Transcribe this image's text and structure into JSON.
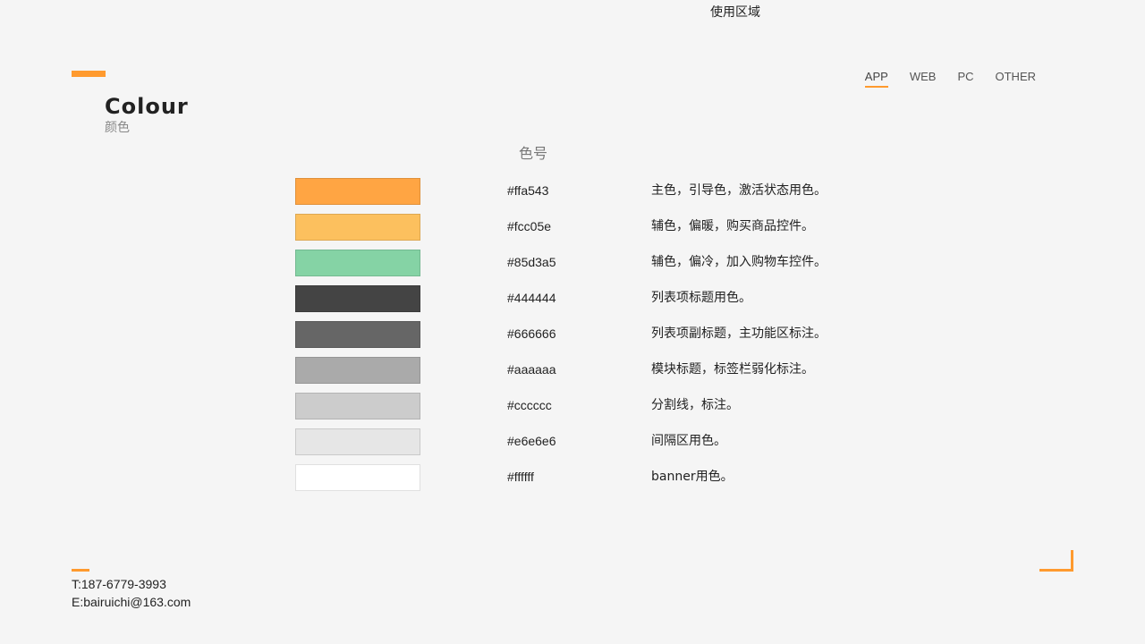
{
  "title": {
    "en": "Colour",
    "cn": "颜色"
  },
  "nav": {
    "items": [
      {
        "label": "APP",
        "active": true
      },
      {
        "label": "WEB",
        "active": false
      },
      {
        "label": "PC",
        "active": false
      },
      {
        "label": "OTHER",
        "active": false
      }
    ]
  },
  "table": {
    "headers": {
      "code": "色号",
      "usage": "使用区域"
    },
    "rows": [
      {
        "color": "#ffa543",
        "hex": "#ffa543",
        "usage": "主色，引导色，激活状态用色。"
      },
      {
        "color": "#fcc05e",
        "hex": "#fcc05e",
        "usage": "辅色，偏暖，购买商品控件。"
      },
      {
        "color": "#85d3a5",
        "hex": "#85d3a5",
        "usage": "辅色，偏冷，加入购物车控件。"
      },
      {
        "color": "#444444",
        "hex": "#444444",
        "usage": "列表项标题用色。"
      },
      {
        "color": "#666666",
        "hex": "#666666",
        "usage": "列表项副标题，主功能区标注。"
      },
      {
        "color": "#aaaaaa",
        "hex": "#aaaaaa",
        "usage": "模块标题，标签栏弱化标注。"
      },
      {
        "color": "#cccccc",
        "hex": "#cccccc",
        "usage": "分割线，标注。"
      },
      {
        "color": "#e6e6e6",
        "hex": "#e6e6e6",
        "usage": "间隔区用色。"
      },
      {
        "color": "#ffffff",
        "hex": "#ffffff",
        "usage": "banner用色。"
      }
    ]
  },
  "contact": {
    "phone": "T:187-6779-3993",
    "email": "E:bairuichi@163.com"
  },
  "accent_color": "#ff9a2e",
  "background_color": "#f5f5f5"
}
